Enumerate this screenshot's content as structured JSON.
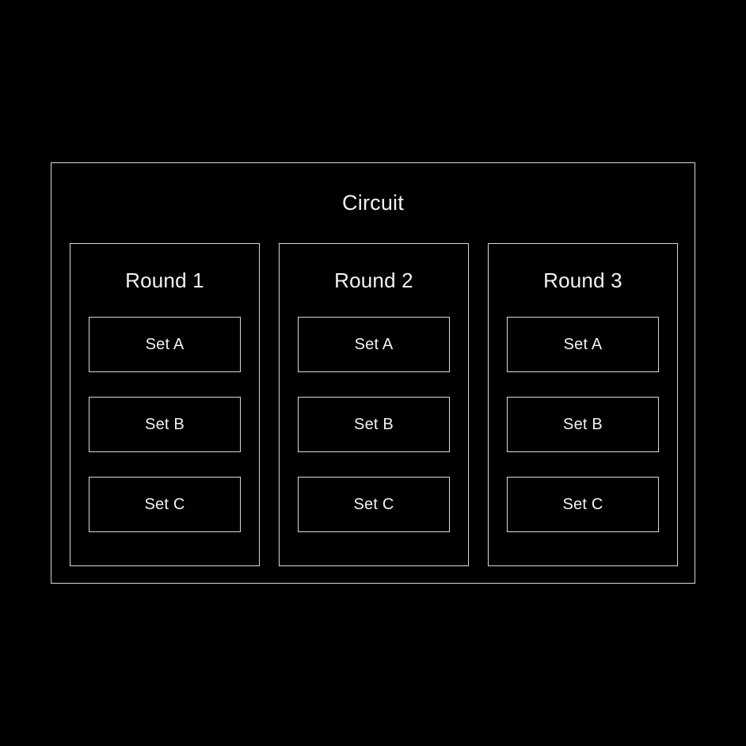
{
  "canvas": {
    "background_color": "#000000",
    "line_color": "#d8d8d8",
    "text_color": "#f2f2f2"
  },
  "diagram": {
    "title": "Circuit",
    "rounds": [
      {
        "label": "Round 1",
        "sets": [
          {
            "label": "Set A"
          },
          {
            "label": "Set B"
          },
          {
            "label": "Set C"
          }
        ]
      },
      {
        "label": "Round 2",
        "sets": [
          {
            "label": "Set A"
          },
          {
            "label": "Set B"
          },
          {
            "label": "Set C"
          }
        ]
      },
      {
        "label": "Round 3",
        "sets": [
          {
            "label": "Set A"
          },
          {
            "label": "Set B"
          },
          {
            "label": "Set C"
          }
        ]
      }
    ]
  }
}
